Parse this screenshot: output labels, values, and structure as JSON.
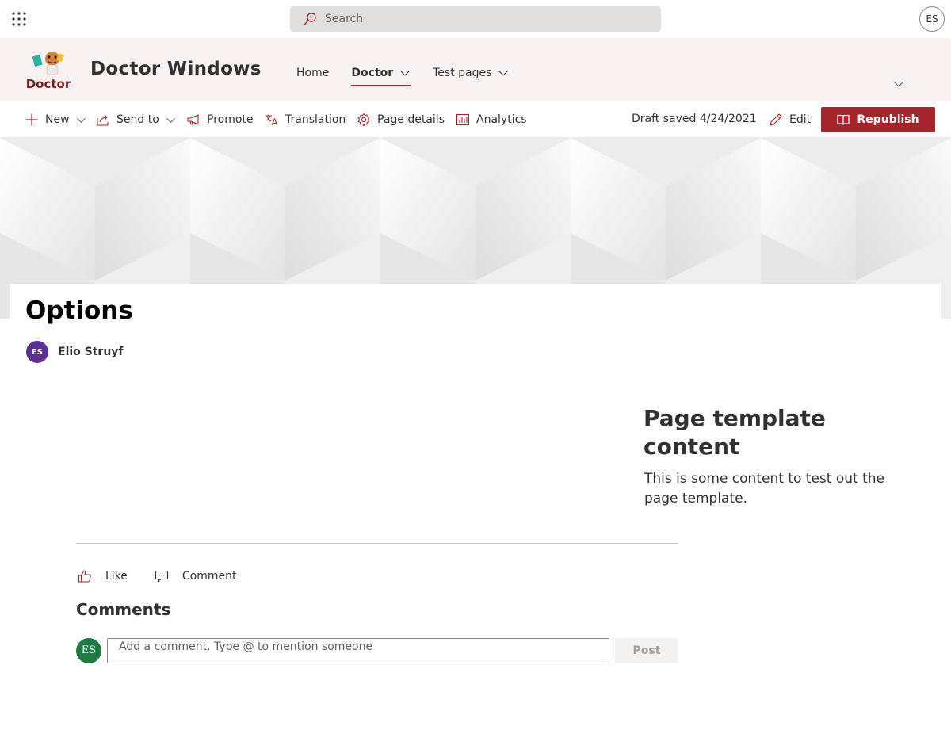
{
  "suitebar": {
    "search_placeholder": "Search",
    "me_initials": "ES"
  },
  "site": {
    "logo_text": "Doctor",
    "title": "Doctor Windows",
    "nav": [
      {
        "label": "Home",
        "active": false,
        "has_dropdown": false
      },
      {
        "label": "Doctor",
        "active": true,
        "has_dropdown": true
      },
      {
        "label": "Test pages",
        "active": false,
        "has_dropdown": true
      }
    ]
  },
  "commandbar": {
    "new": "New",
    "send_to": "Send to",
    "promote": "Promote",
    "translation": "Translation",
    "page_details": "Page details",
    "analytics": "Analytics",
    "draft_status": "Draft saved 4/24/2021",
    "edit": "Edit",
    "republish": "Republish"
  },
  "page": {
    "title": "Options",
    "author_initials": "ES",
    "author_name": "Elio Struyf"
  },
  "content": {
    "heading": "Page template content",
    "body": "This is some content to test out the page template."
  },
  "social": {
    "like": "Like",
    "comment": "Comment"
  },
  "comments": {
    "heading": "Comments",
    "avatar_initials": "ES",
    "input_placeholder": "Add a comment. Type @ to mention someone",
    "post_label": "Post"
  },
  "colors": {
    "accent": "#a4262c",
    "header_bg": "#f8f2f2",
    "author_avatar": "#5c2e91",
    "comment_avatar": "#1f7a46"
  }
}
